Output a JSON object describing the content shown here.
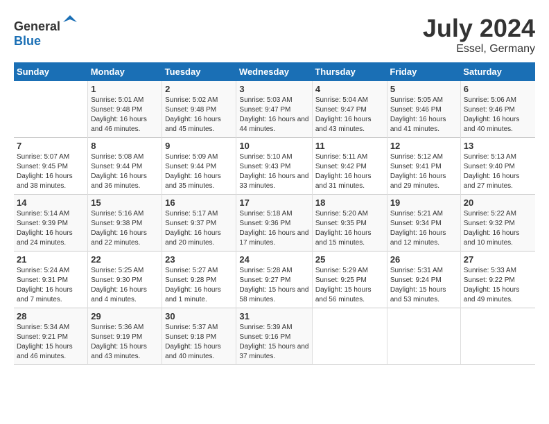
{
  "header": {
    "logo_general": "General",
    "logo_blue": "Blue",
    "title": "July 2024",
    "location": "Essel, Germany"
  },
  "columns": [
    "Sunday",
    "Monday",
    "Tuesday",
    "Wednesday",
    "Thursday",
    "Friday",
    "Saturday"
  ],
  "weeks": [
    [
      {
        "day": "",
        "sunrise": "",
        "sunset": "",
        "daylight": ""
      },
      {
        "day": "1",
        "sunrise": "Sunrise: 5:01 AM",
        "sunset": "Sunset: 9:48 PM",
        "daylight": "Daylight: 16 hours and 46 minutes."
      },
      {
        "day": "2",
        "sunrise": "Sunrise: 5:02 AM",
        "sunset": "Sunset: 9:48 PM",
        "daylight": "Daylight: 16 hours and 45 minutes."
      },
      {
        "day": "3",
        "sunrise": "Sunrise: 5:03 AM",
        "sunset": "Sunset: 9:47 PM",
        "daylight": "Daylight: 16 hours and 44 minutes."
      },
      {
        "day": "4",
        "sunrise": "Sunrise: 5:04 AM",
        "sunset": "Sunset: 9:47 PM",
        "daylight": "Daylight: 16 hours and 43 minutes."
      },
      {
        "day": "5",
        "sunrise": "Sunrise: 5:05 AM",
        "sunset": "Sunset: 9:46 PM",
        "daylight": "Daylight: 16 hours and 41 minutes."
      },
      {
        "day": "6",
        "sunrise": "Sunrise: 5:06 AM",
        "sunset": "Sunset: 9:46 PM",
        "daylight": "Daylight: 16 hours and 40 minutes."
      }
    ],
    [
      {
        "day": "7",
        "sunrise": "Sunrise: 5:07 AM",
        "sunset": "Sunset: 9:45 PM",
        "daylight": "Daylight: 16 hours and 38 minutes."
      },
      {
        "day": "8",
        "sunrise": "Sunrise: 5:08 AM",
        "sunset": "Sunset: 9:44 PM",
        "daylight": "Daylight: 16 hours and 36 minutes."
      },
      {
        "day": "9",
        "sunrise": "Sunrise: 5:09 AM",
        "sunset": "Sunset: 9:44 PM",
        "daylight": "Daylight: 16 hours and 35 minutes."
      },
      {
        "day": "10",
        "sunrise": "Sunrise: 5:10 AM",
        "sunset": "Sunset: 9:43 PM",
        "daylight": "Daylight: 16 hours and 33 minutes."
      },
      {
        "day": "11",
        "sunrise": "Sunrise: 5:11 AM",
        "sunset": "Sunset: 9:42 PM",
        "daylight": "Daylight: 16 hours and 31 minutes."
      },
      {
        "day": "12",
        "sunrise": "Sunrise: 5:12 AM",
        "sunset": "Sunset: 9:41 PM",
        "daylight": "Daylight: 16 hours and 29 minutes."
      },
      {
        "day": "13",
        "sunrise": "Sunrise: 5:13 AM",
        "sunset": "Sunset: 9:40 PM",
        "daylight": "Daylight: 16 hours and 27 minutes."
      }
    ],
    [
      {
        "day": "14",
        "sunrise": "Sunrise: 5:14 AM",
        "sunset": "Sunset: 9:39 PM",
        "daylight": "Daylight: 16 hours and 24 minutes."
      },
      {
        "day": "15",
        "sunrise": "Sunrise: 5:16 AM",
        "sunset": "Sunset: 9:38 PM",
        "daylight": "Daylight: 16 hours and 22 minutes."
      },
      {
        "day": "16",
        "sunrise": "Sunrise: 5:17 AM",
        "sunset": "Sunset: 9:37 PM",
        "daylight": "Daylight: 16 hours and 20 minutes."
      },
      {
        "day": "17",
        "sunrise": "Sunrise: 5:18 AM",
        "sunset": "Sunset: 9:36 PM",
        "daylight": "Daylight: 16 hours and 17 minutes."
      },
      {
        "day": "18",
        "sunrise": "Sunrise: 5:20 AM",
        "sunset": "Sunset: 9:35 PM",
        "daylight": "Daylight: 16 hours and 15 minutes."
      },
      {
        "day": "19",
        "sunrise": "Sunrise: 5:21 AM",
        "sunset": "Sunset: 9:34 PM",
        "daylight": "Daylight: 16 hours and 12 minutes."
      },
      {
        "day": "20",
        "sunrise": "Sunrise: 5:22 AM",
        "sunset": "Sunset: 9:32 PM",
        "daylight": "Daylight: 16 hours and 10 minutes."
      }
    ],
    [
      {
        "day": "21",
        "sunrise": "Sunrise: 5:24 AM",
        "sunset": "Sunset: 9:31 PM",
        "daylight": "Daylight: 16 hours and 7 minutes."
      },
      {
        "day": "22",
        "sunrise": "Sunrise: 5:25 AM",
        "sunset": "Sunset: 9:30 PM",
        "daylight": "Daylight: 16 hours and 4 minutes."
      },
      {
        "day": "23",
        "sunrise": "Sunrise: 5:27 AM",
        "sunset": "Sunset: 9:28 PM",
        "daylight": "Daylight: 16 hours and 1 minute."
      },
      {
        "day": "24",
        "sunrise": "Sunrise: 5:28 AM",
        "sunset": "Sunset: 9:27 PM",
        "daylight": "Daylight: 15 hours and 58 minutes."
      },
      {
        "day": "25",
        "sunrise": "Sunrise: 5:29 AM",
        "sunset": "Sunset: 9:25 PM",
        "daylight": "Daylight: 15 hours and 56 minutes."
      },
      {
        "day": "26",
        "sunrise": "Sunrise: 5:31 AM",
        "sunset": "Sunset: 9:24 PM",
        "daylight": "Daylight: 15 hours and 53 minutes."
      },
      {
        "day": "27",
        "sunrise": "Sunrise: 5:33 AM",
        "sunset": "Sunset: 9:22 PM",
        "daylight": "Daylight: 15 hours and 49 minutes."
      }
    ],
    [
      {
        "day": "28",
        "sunrise": "Sunrise: 5:34 AM",
        "sunset": "Sunset: 9:21 PM",
        "daylight": "Daylight: 15 hours and 46 minutes."
      },
      {
        "day": "29",
        "sunrise": "Sunrise: 5:36 AM",
        "sunset": "Sunset: 9:19 PM",
        "daylight": "Daylight: 15 hours and 43 minutes."
      },
      {
        "day": "30",
        "sunrise": "Sunrise: 5:37 AM",
        "sunset": "Sunset: 9:18 PM",
        "daylight": "Daylight: 15 hours and 40 minutes."
      },
      {
        "day": "31",
        "sunrise": "Sunrise: 5:39 AM",
        "sunset": "Sunset: 9:16 PM",
        "daylight": "Daylight: 15 hours and 37 minutes."
      },
      {
        "day": "",
        "sunrise": "",
        "sunset": "",
        "daylight": ""
      },
      {
        "day": "",
        "sunrise": "",
        "sunset": "",
        "daylight": ""
      },
      {
        "day": "",
        "sunrise": "",
        "sunset": "",
        "daylight": ""
      }
    ]
  ]
}
